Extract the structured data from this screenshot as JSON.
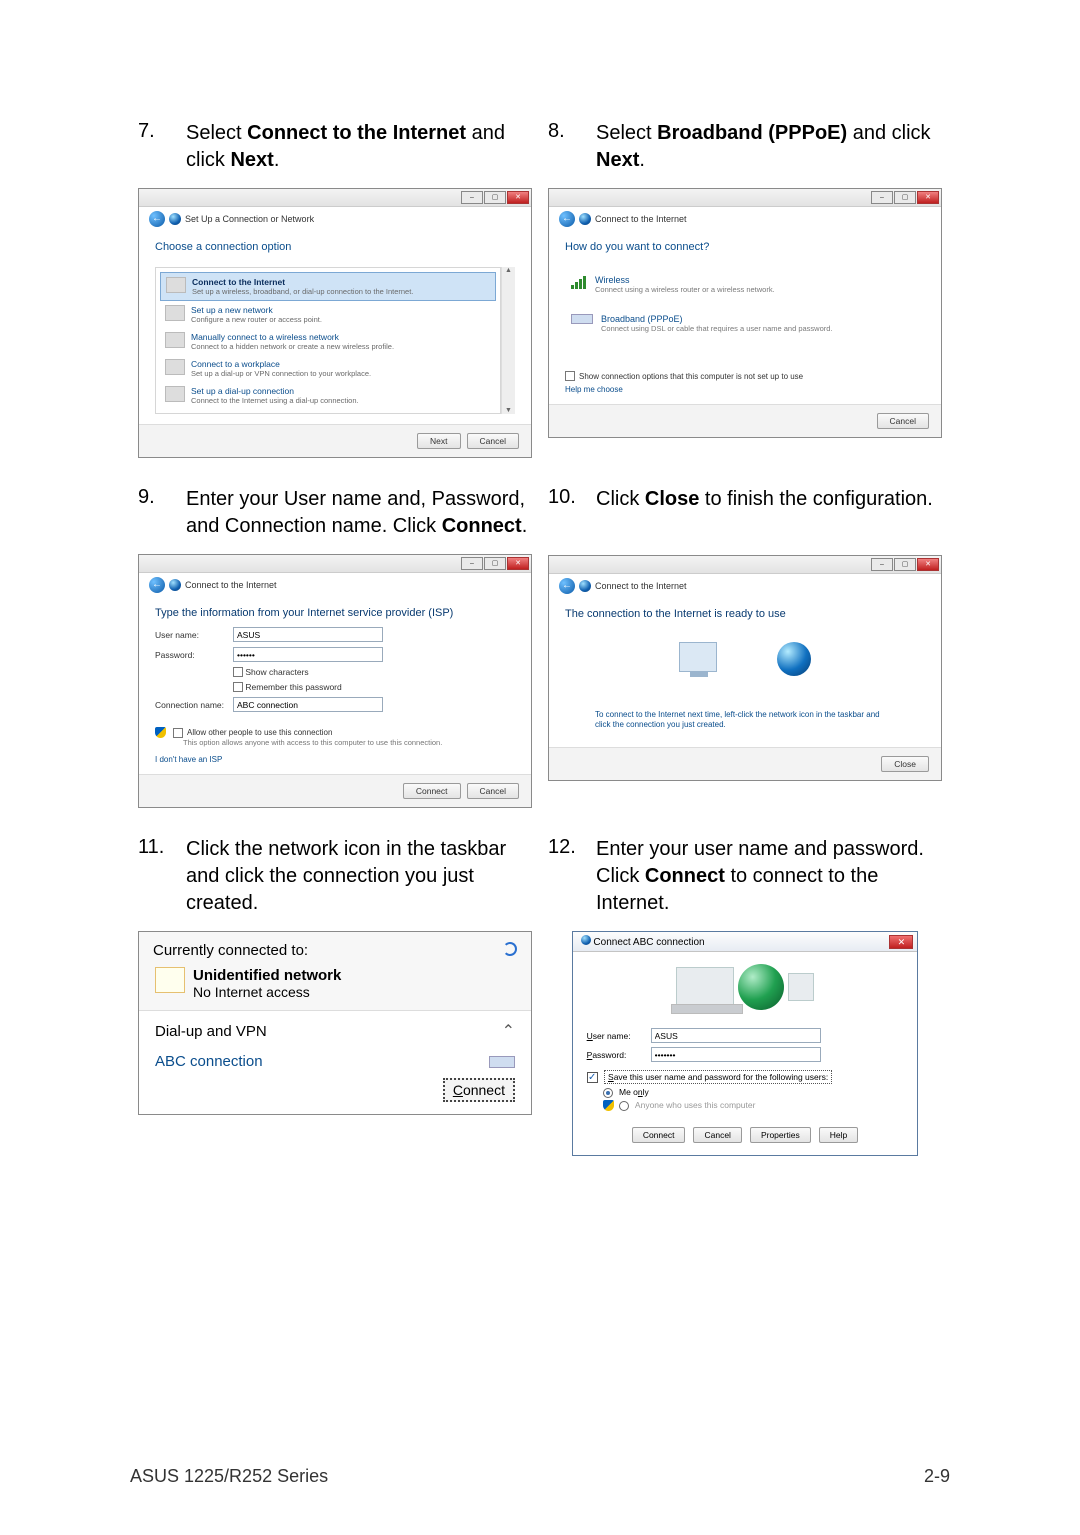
{
  "steps": {
    "s7": {
      "num": "7.",
      "text_before": "Select ",
      "bold1": "Connect to the Internet",
      "text_mid": " and click ",
      "bold2": "Next",
      "text_after": "."
    },
    "s8": {
      "num": "8.",
      "text_before": "Select ",
      "bold1": "Broadband (PPPoE)",
      "text_mid": " and click ",
      "bold2": "Next",
      "text_after": "."
    },
    "s9": {
      "num": "9.",
      "text": "Enter your User name and, Password, and Connection name. Click ",
      "bold": "Connect",
      "text_after": "."
    },
    "s10": {
      "num": "10.",
      "text_before": "Click ",
      "bold": "Close",
      "text_after": " to finish the configuration."
    },
    "s11": {
      "num": "11.",
      "text": "Click the network icon in the taskbar and click the connection you just created."
    },
    "s12": {
      "num": "12.",
      "text_before": "Enter your user name and password. Click ",
      "bold": "Connect",
      "text_after": " to connect to the Internet."
    }
  },
  "win7": {
    "crumb": "Set Up a Connection or Network",
    "heading": "Choose a connection option",
    "options": [
      {
        "title": "Connect to the Internet",
        "desc": "Set up a wireless, broadband, or dial-up connection to the Internet."
      },
      {
        "title": "Set up a new network",
        "desc": "Configure a new router or access point."
      },
      {
        "title": "Manually connect to a wireless network",
        "desc": "Connect to a hidden network or create a new wireless profile."
      },
      {
        "title": "Connect to a workplace",
        "desc": "Set up a dial-up or VPN connection to your workplace."
      },
      {
        "title": "Set up a dial-up connection",
        "desc": "Connect to the Internet using a dial-up connection."
      }
    ],
    "btn_next": "Next",
    "btn_cancel": "Cancel"
  },
  "win8": {
    "crumb": "Connect to the Internet",
    "heading": "How do you want to connect?",
    "opt_wireless": {
      "title": "Wireless",
      "desc": "Connect using a wireless router or a wireless network."
    },
    "opt_broadband": {
      "title": "Broadband (PPPoE)",
      "desc": "Connect using DSL or cable that requires a user name and password."
    },
    "show_options": "Show connection options that this computer is not set up to use",
    "help": "Help me choose",
    "btn_cancel": "Cancel"
  },
  "win9": {
    "crumb": "Connect to the Internet",
    "heading": "Type the information from your Internet service provider (ISP)",
    "lbl_user": "User name:",
    "val_user": "ASUS",
    "lbl_pass": "Password:",
    "val_pass": "••••••",
    "chk_show": "Show characters",
    "chk_remember": "Remember this password",
    "lbl_conn": "Connection name:",
    "val_conn": "ABC connection",
    "chk_allow": "Allow other people to use this connection",
    "allow_desc": "This option allows anyone with access to this computer to use this connection.",
    "link_isp": "I don't have an ISP",
    "btn_connect": "Connect",
    "btn_cancel": "Cancel"
  },
  "win10": {
    "crumb": "Connect to the Internet",
    "heading": "The connection to the Internet is ready to use",
    "tip": "To connect to the Internet next time, left-click the network icon in the taskbar and click the connection you just created.",
    "btn_close": "Close"
  },
  "flyout11": {
    "header": "Currently connected to:",
    "net_title": "Unidentified network",
    "net_sub": "No Internet access",
    "section": "Dial-up and VPN",
    "conn_name": "ABC connection",
    "btn_connect": "Connect"
  },
  "dlg12": {
    "title": "Connect ABC connection",
    "lbl_user": "User name:",
    "val_user": "ASUS",
    "lbl_pass": "Password:",
    "val_pass": "•••••••",
    "chk_save": "Save this user name and password for the following users:",
    "radio_me": "Me only",
    "radio_any": "Anyone who uses this computer",
    "btn_connect": "Connect",
    "btn_cancel": "Cancel",
    "btn_props": "Properties",
    "btn_help": "Help"
  },
  "footer": {
    "left": "ASUS 1225/R252 Series",
    "right": "2-9"
  }
}
